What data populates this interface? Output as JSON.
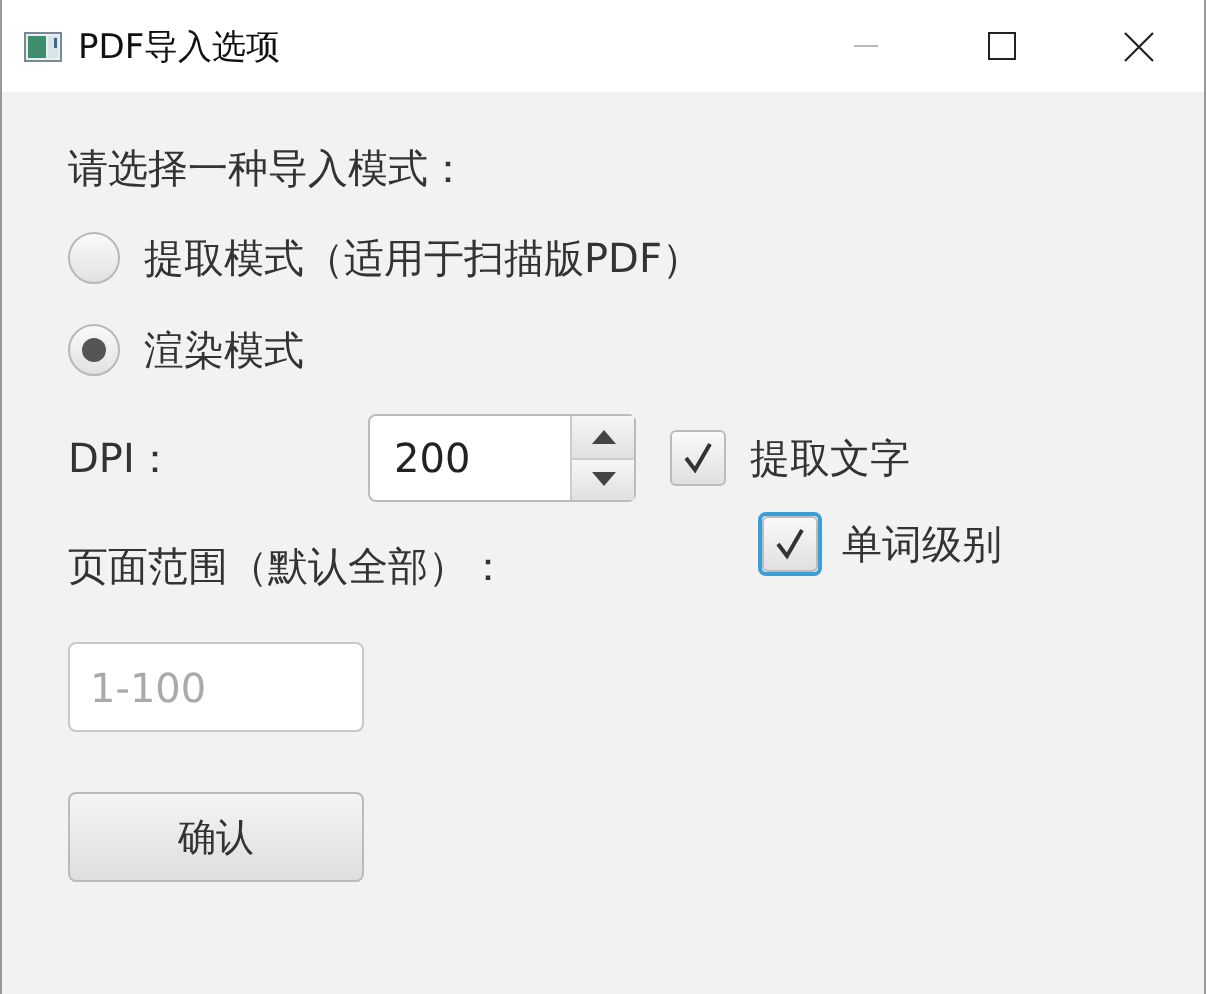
{
  "window": {
    "title": "PDF导入选项"
  },
  "prompt": "请选择一种导入模式：",
  "modes": [
    {
      "label": "提取模式（适用于扫描版PDF）",
      "selected": false
    },
    {
      "label": "渲染模式",
      "selected": true
    }
  ],
  "dpi": {
    "label": "DPI：",
    "value": "200"
  },
  "checkboxes": [
    {
      "label": "提取文字",
      "checked": true,
      "focused": false
    },
    {
      "label": "单词级别",
      "checked": true,
      "focused": true
    }
  ],
  "page_range": {
    "label": "页面范围（默认全部）：",
    "placeholder": "1-100"
  },
  "buttons": [
    "确认"
  ]
}
